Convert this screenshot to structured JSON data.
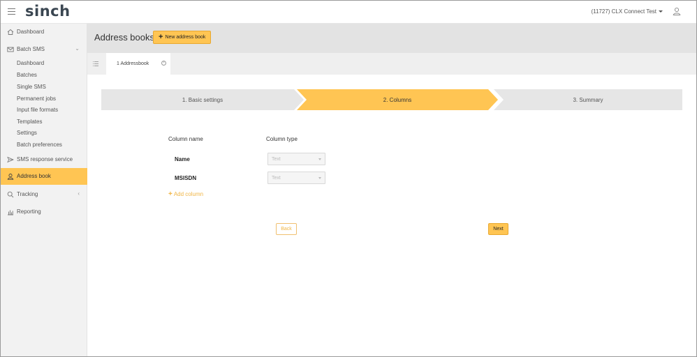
{
  "topbar": {
    "logo": "sinch",
    "account_label": "(11727) CLX Connect Test"
  },
  "sidebar": {
    "dashboard": "Dashboard",
    "batch_sms": "Batch SMS",
    "batch_sub": [
      "Dashboard",
      "Batches",
      "Single SMS",
      "Permanent jobs",
      "Input file formats",
      "Templates",
      "Settings",
      "Batch preferences"
    ],
    "sms_response": "SMS response service",
    "address_book": "Address book",
    "tracking": "Tracking",
    "reporting": "Reporting"
  },
  "header": {
    "title": "Address books",
    "new_button": "New address book"
  },
  "tabs": {
    "active_tab": "1 Addressbook"
  },
  "wizard": {
    "steps": [
      "1. Basic settings",
      "2. Columns",
      "3. Summary"
    ],
    "active_step": 2
  },
  "columns_form": {
    "header_name": "Column name",
    "header_type": "Column type",
    "rows": [
      {
        "name": "Name",
        "type": "Text"
      },
      {
        "name": "MSISDN",
        "type": "Text"
      }
    ],
    "add_column": "Add column"
  },
  "actions": {
    "back": "Back",
    "next": "Next"
  },
  "colors": {
    "accent": "#ffc553",
    "accent_text": "#f0b545",
    "sidebar_bg": "#f2f2f2",
    "header_bg": "#e3e3e3"
  }
}
